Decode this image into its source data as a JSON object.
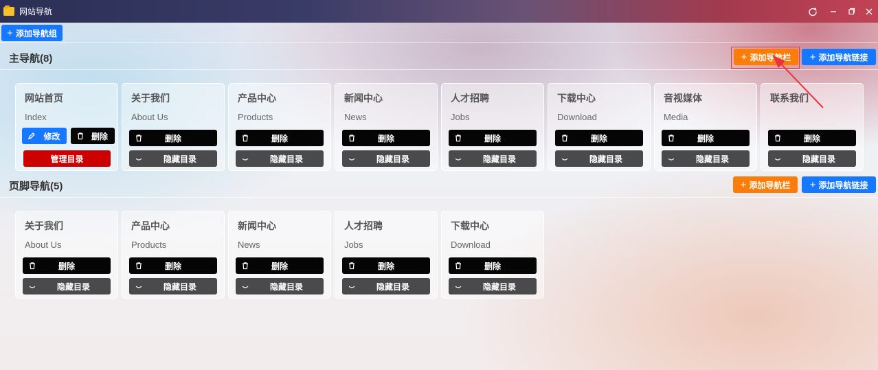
{
  "window": {
    "title": "网站导航",
    "buttons": [
      "refresh-icon",
      "minimize-icon",
      "maximize-icon",
      "close-icon"
    ]
  },
  "toolbar": {
    "add_group_label": "添加导航组"
  },
  "colors": {
    "blue": "#1677ff",
    "orange": "#fa7d0a",
    "delete": "#050505",
    "hide": "#4a4a4c",
    "manage": "#cc0000",
    "highlight": "#e8333a"
  },
  "sections": [
    {
      "title": "主导航(8)",
      "add_bar_label": "添加导航栏",
      "add_link_label": "添加导航链接",
      "first_card": {
        "name": "网站首页",
        "sub": "Index",
        "edit_label": "修改",
        "delete_label": "删除",
        "manage_label": "管理目录"
      },
      "cards": [
        {
          "name": "关于我们",
          "sub": "About Us"
        },
        {
          "name": "产品中心",
          "sub": "Products"
        },
        {
          "name": "新闻中心",
          "sub": "News"
        },
        {
          "name": "人才招聘",
          "sub": "Jobs"
        },
        {
          "name": "下载中心",
          "sub": "Download"
        },
        {
          "name": "音视媒体",
          "sub": "Media"
        },
        {
          "name": "联系我们",
          "sub": ""
        }
      ]
    },
    {
      "title": "页脚导航(5)",
      "add_bar_label": "添加导航栏",
      "add_link_label": "添加导航链接",
      "cards": [
        {
          "name": "关于我们",
          "sub": "About Us"
        },
        {
          "name": "产品中心",
          "sub": "Products"
        },
        {
          "name": "新闻中心",
          "sub": "News"
        },
        {
          "name": "人才招聘",
          "sub": "Jobs"
        },
        {
          "name": "下载中心",
          "sub": "Download"
        }
      ]
    }
  ],
  "card_labels": {
    "delete": "删除",
    "hide": "隐藏目录"
  }
}
